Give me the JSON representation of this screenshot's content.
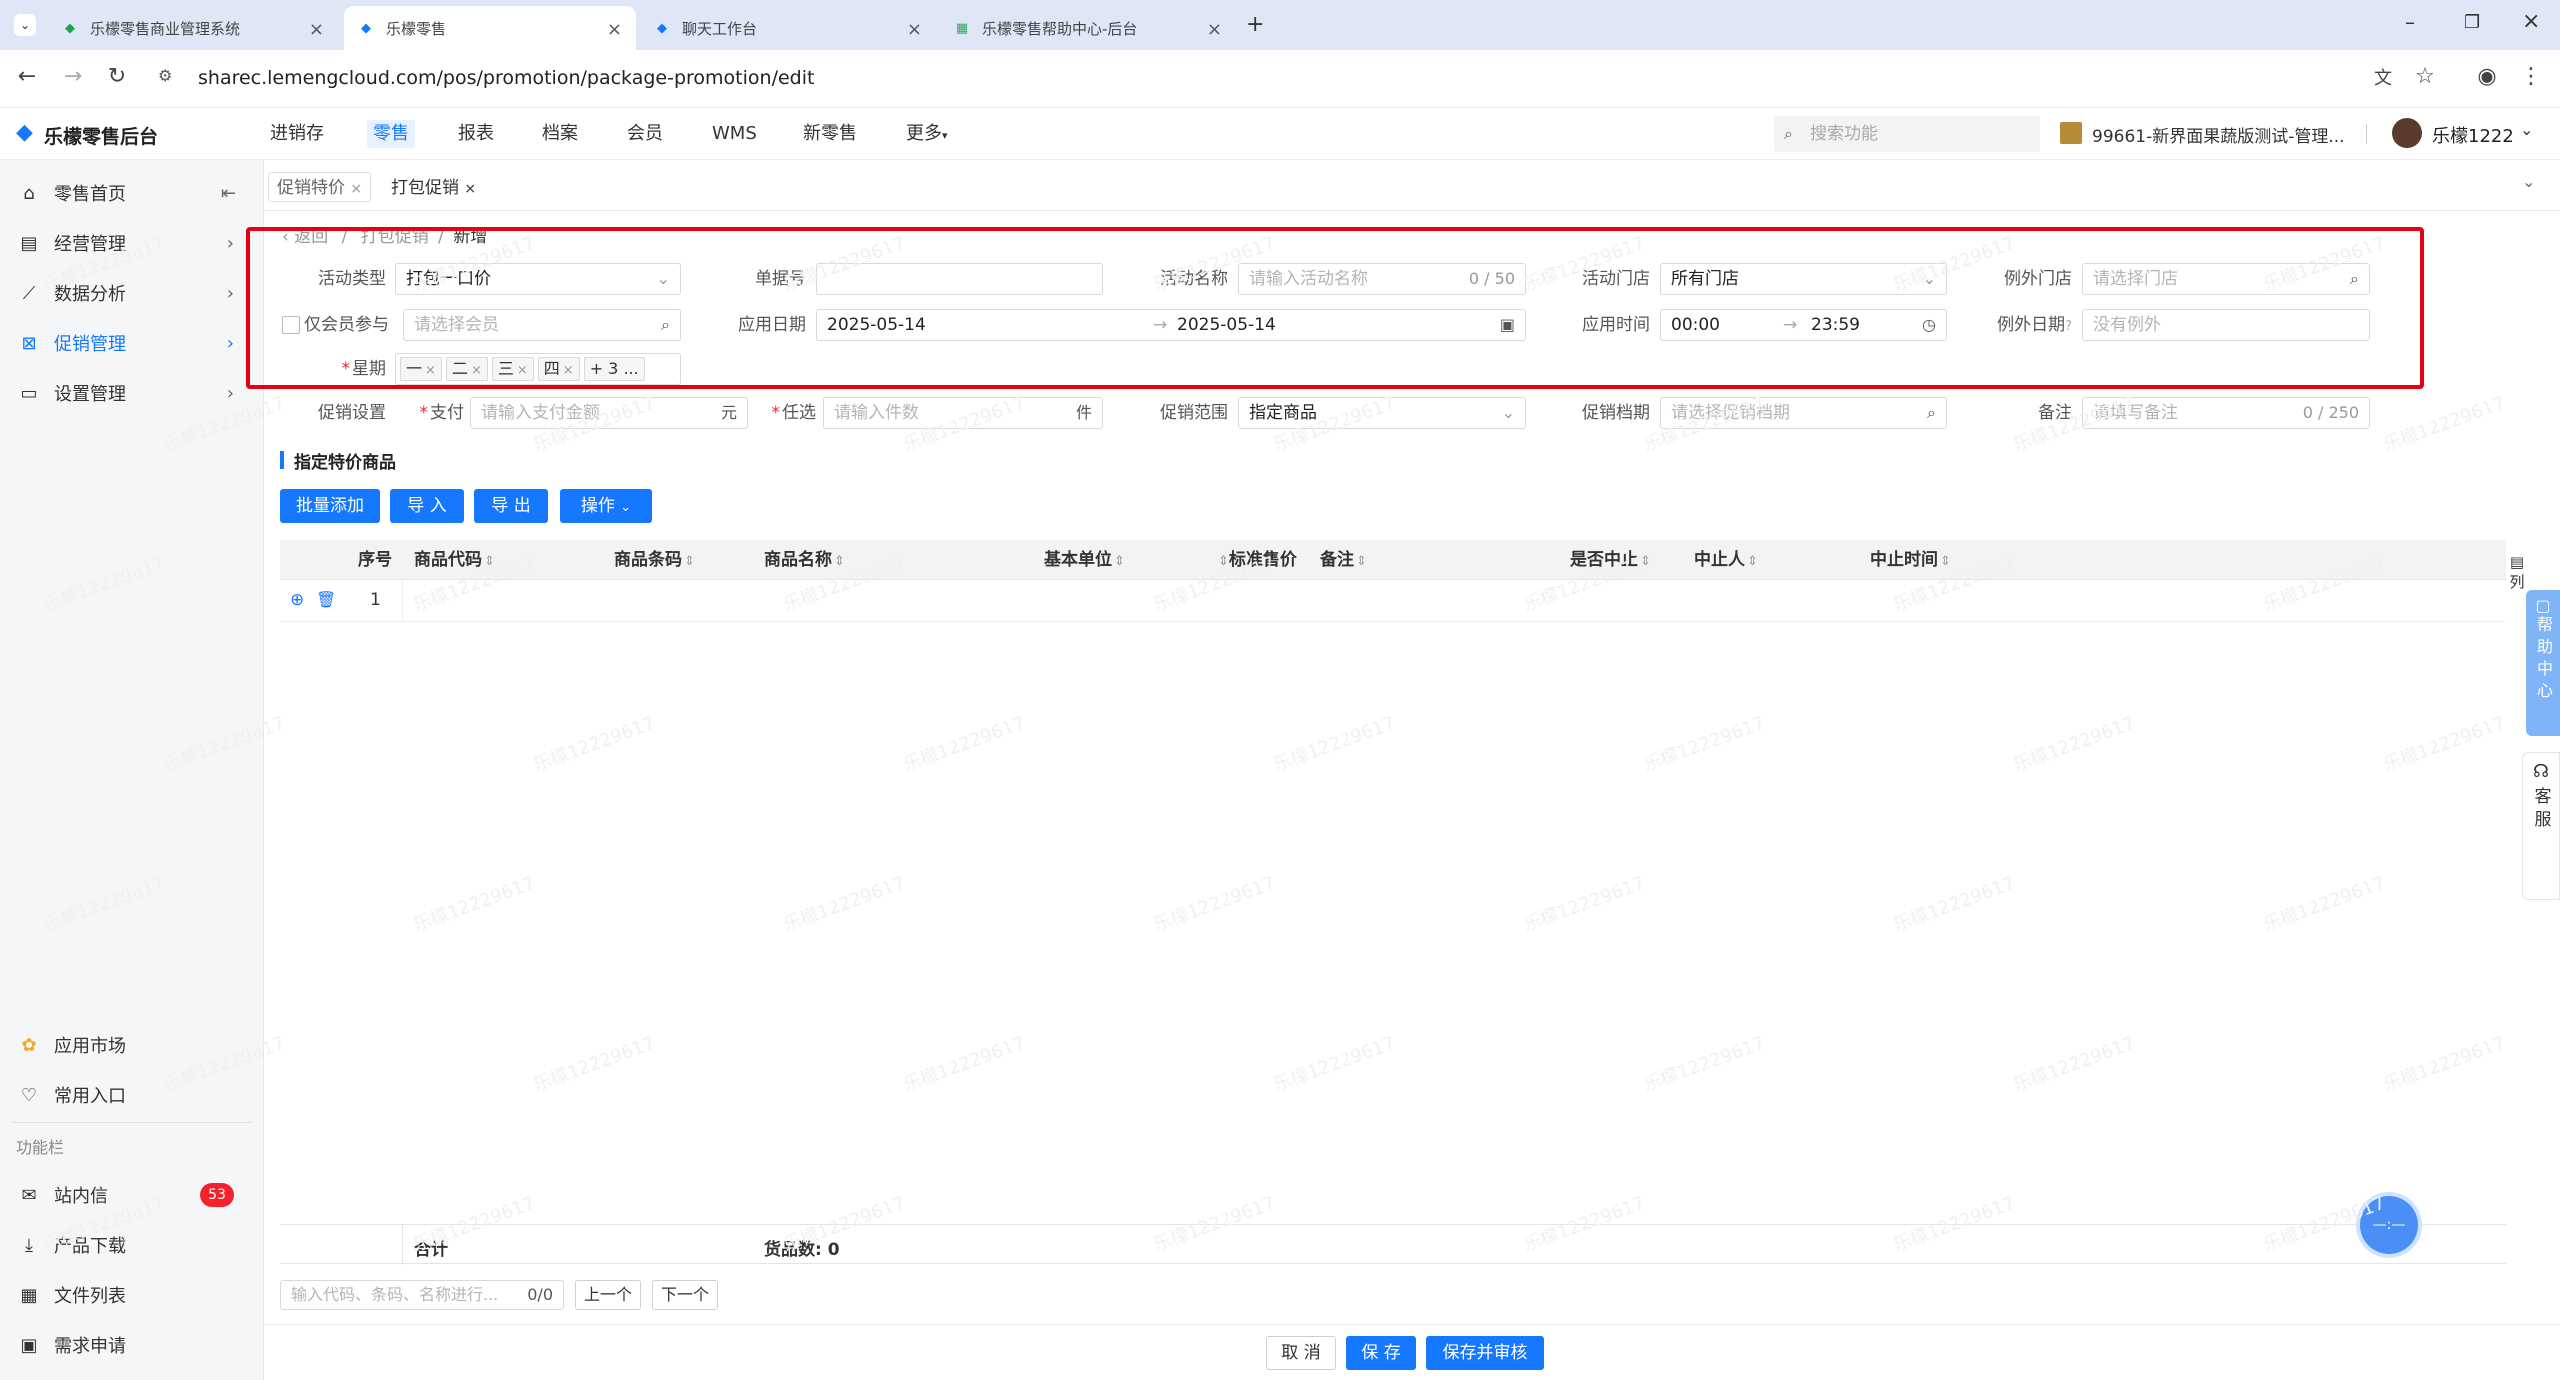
{
  "browser": {
    "tabs": [
      {
        "title": "乐檬零售商业管理系统",
        "active": false
      },
      {
        "title": "乐檬零售",
        "active": true
      },
      {
        "title": "聊天工作台",
        "active": false
      },
      {
        "title": "乐檬零售帮助中心-后台",
        "active": false
      }
    ],
    "url": "sharec.lemengcloud.com/pos/promotion/package-promotion/edit"
  },
  "header": {
    "app_name": "乐檬零售后台",
    "menu": [
      "进销存",
      "零售",
      "报表",
      "档案",
      "会员",
      "WMS",
      "新零售",
      "更多"
    ],
    "active_menu": "零售",
    "search_placeholder": "搜索功能",
    "store": "99661-新界面果蔬版测试-管理...",
    "user": "乐檬1222"
  },
  "sidebar": {
    "items": [
      "零售首页",
      "经营管理",
      "数据分析",
      "促销管理",
      "设置管理"
    ],
    "active": "促销管理",
    "bottom_items": [
      "应用市场",
      "常用入口"
    ],
    "section_label": "功能栏",
    "function_items": [
      "站内信",
      "产品下载",
      "文件列表",
      "需求申请"
    ],
    "inbox_badge": "53"
  },
  "page_tabs": [
    "促销特价",
    "打包促销"
  ],
  "breadcrumb": {
    "back": "返回",
    "parent": "打包促销",
    "current": "新增"
  },
  "form": {
    "activity_type_label": "活动类型",
    "activity_type_value": "打包一口价",
    "doc_no_label": "单据号",
    "activity_name_label": "活动名称",
    "activity_name_placeholder": "请输入活动名称",
    "activity_name_count": "0 / 50",
    "store_label": "活动门店",
    "store_value": "所有门店",
    "except_store_label": "例外门店",
    "except_store_placeholder": "请选择门店",
    "member_only_label": "仅会员参与",
    "member_placeholder": "请选择会员",
    "apply_date_label": "应用日期",
    "date_start": "2025-05-14",
    "date_end": "2025-05-14",
    "apply_time_label": "应用时间",
    "time_start": "00:00",
    "time_end": "23:59",
    "except_date_label": "例外日期",
    "except_date_placeholder": "没有例外",
    "weekday_label": "星期",
    "weekdays": [
      "一",
      "二",
      "三",
      "四"
    ],
    "weekday_more": "+ 3 ...",
    "promo_setting_label": "促销设置",
    "pay_label": "支付",
    "pay_placeholder": "请输入支付金额",
    "pay_unit": "元",
    "pick_label": "任选",
    "pick_placeholder": "请输入件数",
    "pick_unit": "件",
    "scope_label": "促销范围",
    "scope_value": "指定商品",
    "schedule_label": "促销档期",
    "schedule_placeholder": "请选择促销档期",
    "remark_label": "备注",
    "remark_placeholder": "请填写备注",
    "remark_count": "0 / 250"
  },
  "goods": {
    "section_title": "指定特价商品",
    "buttons": {
      "batch_add": "批量添加",
      "import": "导 入",
      "export": "导 出",
      "ops": "操作"
    },
    "columns": [
      "序号",
      "商品代码",
      "商品条码",
      "商品名称",
      "基本单位",
      "标准售价",
      "备注",
      "是否中止",
      "中止人",
      "中止时间"
    ],
    "rows": [
      {
        "index": "1"
      }
    ],
    "footer_total": "合计",
    "footer_count": "货品数: 0",
    "search_placeholder": "输入代码、条码、名称进行...",
    "search_count": "0/0",
    "prev": "上一个",
    "next": "下一个"
  },
  "side_tools": {
    "columns": "列",
    "help": "帮助中心",
    "service": "客服"
  },
  "actions": {
    "cancel": "取 消",
    "save": "保 存",
    "save_audit": "保存并审核"
  },
  "watermark": "乐檬12229617"
}
